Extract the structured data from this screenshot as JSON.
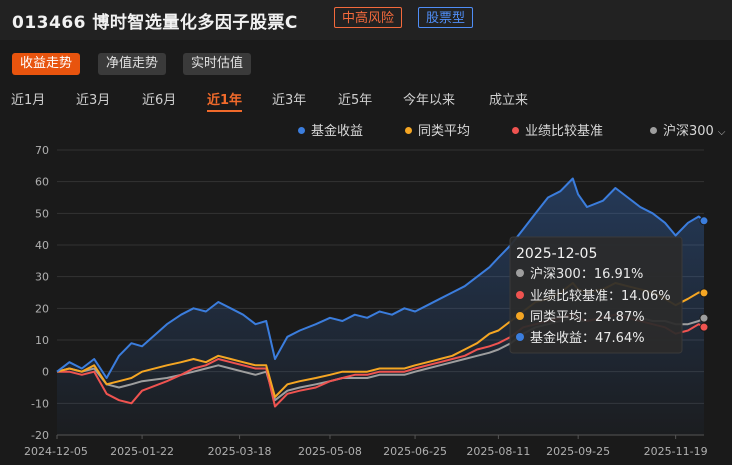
{
  "header": {
    "title": "013466  博时智选量化多因子股票C",
    "risk_badge": "中高风险",
    "type_badge": "股票型",
    "colors": {
      "risk": "#f36a3c",
      "type": "#4f8ef7"
    }
  },
  "view_tabs": [
    {
      "label": "收益走势",
      "active": true
    },
    {
      "label": "净值走势",
      "active": false
    },
    {
      "label": "实时估值",
      "active": false
    }
  ],
  "periods": [
    {
      "label": "近1月",
      "active": false
    },
    {
      "label": "近3月",
      "active": false
    },
    {
      "label": "近6月",
      "active": false
    },
    {
      "label": "近1年",
      "active": true
    },
    {
      "label": "近3年",
      "active": false
    },
    {
      "label": "近5年",
      "active": false
    },
    {
      "label": "今年以来",
      "active": false
    },
    {
      "label": "成立来",
      "active": false
    }
  ],
  "legend": [
    {
      "label": "基金收益",
      "color": "#3b7ddd"
    },
    {
      "label": "同类平均",
      "color": "#f5a623"
    },
    {
      "label": "业绩比较基准",
      "color": "#ef5350"
    },
    {
      "label": "沪深300",
      "color": "#9e9e9e",
      "dropdown_icon": "chevron-down-icon"
    }
  ],
  "tooltip": {
    "date": "2025-12-05",
    "rows": [
      {
        "label": "沪深300：16.91%",
        "color": "#9e9e9e"
      },
      {
        "label": "业绩比较基准：14.06%",
        "color": "#ef5350"
      },
      {
        "label": "同类平均：24.87%",
        "color": "#f5a623"
      },
      {
        "label": "基金收益：47.64%",
        "color": "#3b7ddd"
      }
    ]
  },
  "chart_data": {
    "type": "area",
    "ylim": [
      -20,
      70
    ],
    "yticks": [
      -20,
      -10,
      0,
      10,
      20,
      30,
      40,
      50,
      60,
      70
    ],
    "xlim": [
      "2024-12-05",
      "2025-12-05"
    ],
    "xtick_labels": [
      "2024-12-05",
      "2025-01-22",
      "2025-03-18",
      "2025-05-08",
      "2025-06-25",
      "2025-08-11",
      "2025-09-25",
      "2025-11-19"
    ],
    "grid": "horizontal",
    "legend_position": "top-right",
    "series": [
      {
        "name": "基金收益",
        "color": "#3b7ddd",
        "fill": true,
        "points": [
          [
            "2024-12-05",
            0
          ],
          [
            "2024-12-12",
            3
          ],
          [
            "2024-12-19",
            1
          ],
          [
            "2024-12-26",
            4
          ],
          [
            "2025-01-02",
            -2
          ],
          [
            "2025-01-09",
            5
          ],
          [
            "2025-01-16",
            9
          ],
          [
            "2025-01-22",
            8
          ],
          [
            "2025-02-05",
            15
          ],
          [
            "2025-02-13",
            18
          ],
          [
            "2025-02-20",
            20
          ],
          [
            "2025-02-27",
            19
          ],
          [
            "2025-03-06",
            22
          ],
          [
            "2025-03-13",
            20
          ],
          [
            "2025-03-20",
            18
          ],
          [
            "2025-03-27",
            15
          ],
          [
            "2025-04-02",
            16
          ],
          [
            "2025-04-07",
            4
          ],
          [
            "2025-04-14",
            11
          ],
          [
            "2025-04-21",
            13
          ],
          [
            "2025-04-30",
            15
          ],
          [
            "2025-05-08",
            17
          ],
          [
            "2025-05-15",
            16
          ],
          [
            "2025-05-22",
            18
          ],
          [
            "2025-05-29",
            17
          ],
          [
            "2025-06-05",
            19
          ],
          [
            "2025-06-12",
            18
          ],
          [
            "2025-06-19",
            20
          ],
          [
            "2025-06-25",
            19
          ],
          [
            "2025-07-02",
            21
          ],
          [
            "2025-07-09",
            23
          ],
          [
            "2025-07-16",
            25
          ],
          [
            "2025-07-23",
            27
          ],
          [
            "2025-07-30",
            30
          ],
          [
            "2025-08-06",
            33
          ],
          [
            "2025-08-11",
            36
          ],
          [
            "2025-08-18",
            40
          ],
          [
            "2025-08-25",
            45
          ],
          [
            "2025-09-01",
            50
          ],
          [
            "2025-09-08",
            55
          ],
          [
            "2025-09-15",
            57
          ],
          [
            "2025-09-22",
            61
          ],
          [
            "2025-09-25",
            56
          ],
          [
            "2025-09-30",
            52
          ],
          [
            "2025-10-09",
            54
          ],
          [
            "2025-10-16",
            58
          ],
          [
            "2025-10-23",
            55
          ],
          [
            "2025-10-30",
            52
          ],
          [
            "2025-11-06",
            50
          ],
          [
            "2025-11-13",
            47
          ],
          [
            "2025-11-19",
            43
          ],
          [
            "2025-11-26",
            47
          ],
          [
            "2025-12-02",
            49
          ],
          [
            "2025-12-05",
            47.64
          ]
        ]
      },
      {
        "name": "同类平均",
        "color": "#f5a623",
        "fill": false,
        "points": [
          [
            "2024-12-05",
            0
          ],
          [
            "2024-12-12",
            1
          ],
          [
            "2024-12-19",
            0
          ],
          [
            "2024-12-26",
            2
          ],
          [
            "2025-01-02",
            -4
          ],
          [
            "2025-01-09",
            -3
          ],
          [
            "2025-01-16",
            -2
          ],
          [
            "2025-01-22",
            0
          ],
          [
            "2025-02-05",
            2
          ],
          [
            "2025-02-13",
            3
          ],
          [
            "2025-02-20",
            4
          ],
          [
            "2025-02-27",
            3
          ],
          [
            "2025-03-06",
            5
          ],
          [
            "2025-03-13",
            4
          ],
          [
            "2025-03-20",
            3
          ],
          [
            "2025-03-27",
            2
          ],
          [
            "2025-04-02",
            2
          ],
          [
            "2025-04-07",
            -8
          ],
          [
            "2025-04-14",
            -4
          ],
          [
            "2025-04-21",
            -3
          ],
          [
            "2025-04-30",
            -2
          ],
          [
            "2025-05-08",
            -1
          ],
          [
            "2025-05-15",
            0
          ],
          [
            "2025-05-22",
            0
          ],
          [
            "2025-05-29",
            0
          ],
          [
            "2025-06-05",
            1
          ],
          [
            "2025-06-12",
            1
          ],
          [
            "2025-06-19",
            1
          ],
          [
            "2025-06-25",
            2
          ],
          [
            "2025-07-02",
            3
          ],
          [
            "2025-07-09",
            4
          ],
          [
            "2025-07-16",
            5
          ],
          [
            "2025-07-23",
            7
          ],
          [
            "2025-07-30",
            9
          ],
          [
            "2025-08-06",
            12
          ],
          [
            "2025-08-11",
            13
          ],
          [
            "2025-08-18",
            16
          ],
          [
            "2025-08-25",
            19
          ],
          [
            "2025-09-01",
            22
          ],
          [
            "2025-09-08",
            23
          ],
          [
            "2025-09-15",
            25
          ],
          [
            "2025-09-22",
            28
          ],
          [
            "2025-09-25",
            26
          ],
          [
            "2025-09-30",
            25
          ],
          [
            "2025-10-09",
            26
          ],
          [
            "2025-10-16",
            28
          ],
          [
            "2025-10-23",
            27
          ],
          [
            "2025-10-30",
            26
          ],
          [
            "2025-11-06",
            25
          ],
          [
            "2025-11-13",
            23
          ],
          [
            "2025-11-19",
            21
          ],
          [
            "2025-11-26",
            23
          ],
          [
            "2025-12-02",
            25
          ],
          [
            "2025-12-05",
            24.87
          ]
        ]
      },
      {
        "name": "业绩比较基准",
        "color": "#ef5350",
        "fill": false,
        "points": [
          [
            "2024-12-05",
            0
          ],
          [
            "2024-12-12",
            0
          ],
          [
            "2024-12-19",
            -1
          ],
          [
            "2024-12-26",
            0
          ],
          [
            "2025-01-02",
            -7
          ],
          [
            "2025-01-09",
            -9
          ],
          [
            "2025-01-16",
            -10
          ],
          [
            "2025-01-22",
            -6
          ],
          [
            "2025-02-05",
            -3
          ],
          [
            "2025-02-13",
            -1
          ],
          [
            "2025-02-20",
            1
          ],
          [
            "2025-02-27",
            2
          ],
          [
            "2025-03-06",
            4
          ],
          [
            "2025-03-13",
            3
          ],
          [
            "2025-03-20",
            2
          ],
          [
            "2025-03-27",
            1
          ],
          [
            "2025-04-02",
            1
          ],
          [
            "2025-04-07",
            -11
          ],
          [
            "2025-04-14",
            -7
          ],
          [
            "2025-04-21",
            -6
          ],
          [
            "2025-04-30",
            -5
          ],
          [
            "2025-05-08",
            -3
          ],
          [
            "2025-05-15",
            -2
          ],
          [
            "2025-05-22",
            -1
          ],
          [
            "2025-05-29",
            -1
          ],
          [
            "2025-06-05",
            0
          ],
          [
            "2025-06-12",
            0
          ],
          [
            "2025-06-19",
            0
          ],
          [
            "2025-06-25",
            1
          ],
          [
            "2025-07-02",
            2
          ],
          [
            "2025-07-09",
            3
          ],
          [
            "2025-07-16",
            4
          ],
          [
            "2025-07-23",
            5
          ],
          [
            "2025-07-30",
            7
          ],
          [
            "2025-08-06",
            8
          ],
          [
            "2025-08-11",
            9
          ],
          [
            "2025-08-18",
            11
          ],
          [
            "2025-08-25",
            14
          ],
          [
            "2025-09-01",
            15
          ],
          [
            "2025-09-08",
            16
          ],
          [
            "2025-09-15",
            17
          ],
          [
            "2025-09-22",
            18
          ],
          [
            "2025-09-25",
            17
          ],
          [
            "2025-09-30",
            16
          ],
          [
            "2025-10-09",
            17
          ],
          [
            "2025-10-16",
            18
          ],
          [
            "2025-10-23",
            17
          ],
          [
            "2025-10-30",
            16
          ],
          [
            "2025-11-06",
            15
          ],
          [
            "2025-11-13",
            14
          ],
          [
            "2025-11-19",
            12
          ],
          [
            "2025-11-26",
            13
          ],
          [
            "2025-12-02",
            15
          ],
          [
            "2025-12-05",
            14.06
          ]
        ]
      },
      {
        "name": "沪深300",
        "color": "#9e9e9e",
        "fill": false,
        "points": [
          [
            "2024-12-05",
            0
          ],
          [
            "2024-12-12",
            1
          ],
          [
            "2024-12-19",
            0
          ],
          [
            "2024-12-26",
            1
          ],
          [
            "2025-01-02",
            -4
          ],
          [
            "2025-01-09",
            -5
          ],
          [
            "2025-01-16",
            -4
          ],
          [
            "2025-01-22",
            -3
          ],
          [
            "2025-02-05",
            -2
          ],
          [
            "2025-02-13",
            -1
          ],
          [
            "2025-02-20",
            0
          ],
          [
            "2025-02-27",
            1
          ],
          [
            "2025-03-06",
            2
          ],
          [
            "2025-03-13",
            1
          ],
          [
            "2025-03-20",
            0
          ],
          [
            "2025-03-27",
            -1
          ],
          [
            "2025-04-02",
            0
          ],
          [
            "2025-04-07",
            -9
          ],
          [
            "2025-04-14",
            -6
          ],
          [
            "2025-04-21",
            -5
          ],
          [
            "2025-04-30",
            -4
          ],
          [
            "2025-05-08",
            -3
          ],
          [
            "2025-05-15",
            -2
          ],
          [
            "2025-05-22",
            -2
          ],
          [
            "2025-05-29",
            -2
          ],
          [
            "2025-06-05",
            -1
          ],
          [
            "2025-06-12",
            -1
          ],
          [
            "2025-06-19",
            -1
          ],
          [
            "2025-06-25",
            0
          ],
          [
            "2025-07-02",
            1
          ],
          [
            "2025-07-09",
            2
          ],
          [
            "2025-07-16",
            3
          ],
          [
            "2025-07-23",
            4
          ],
          [
            "2025-07-30",
            5
          ],
          [
            "2025-08-06",
            6
          ],
          [
            "2025-08-11",
            7
          ],
          [
            "2025-08-18",
            9
          ],
          [
            "2025-08-25",
            12
          ],
          [
            "2025-09-01",
            14
          ],
          [
            "2025-09-08",
            15
          ],
          [
            "2025-09-15",
            16
          ],
          [
            "2025-09-22",
            17
          ],
          [
            "2025-09-25",
            16
          ],
          [
            "2025-09-30",
            16
          ],
          [
            "2025-10-09",
            17
          ],
          [
            "2025-10-16",
            18
          ],
          [
            "2025-10-23",
            18
          ],
          [
            "2025-10-30",
            17
          ],
          [
            "2025-11-06",
            16
          ],
          [
            "2025-11-13",
            16
          ],
          [
            "2025-11-19",
            15
          ],
          [
            "2025-11-26",
            15
          ],
          [
            "2025-12-02",
            16
          ],
          [
            "2025-12-05",
            16.91
          ]
        ]
      }
    ]
  }
}
